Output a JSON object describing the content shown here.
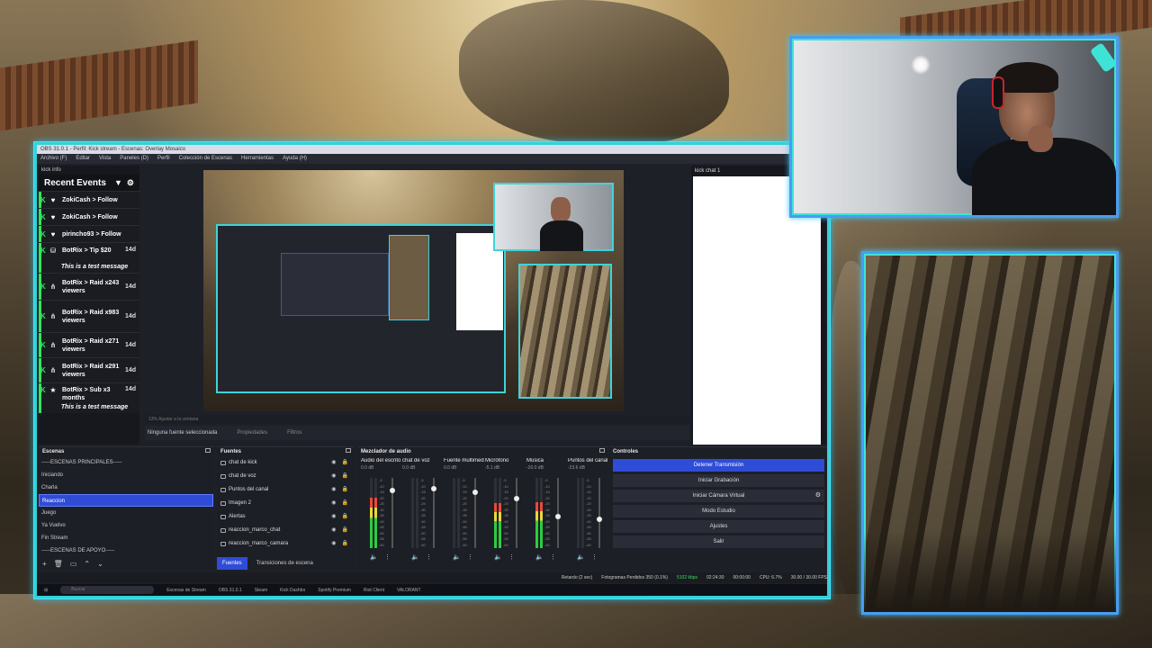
{
  "obs": {
    "titlebar": "OBS 31.0.1 - Perfil: Kick stream - Escenas: Overlay Mosaico",
    "menu": [
      "Archivo (F)",
      "Editar",
      "Vista",
      "Paneles (D)",
      "Perfil",
      "Colección de Escenas",
      "Herramientas",
      "Ayuda (H)"
    ],
    "kick_dock_title": "kick info",
    "recent_events_title": "Recent Events",
    "events": [
      {
        "text": "ZokiCash > Follow",
        "age": "",
        "icon": "heart-icon",
        "msg": ""
      },
      {
        "text": "ZokiCash > Follow",
        "age": "",
        "icon": "heart-icon",
        "msg": ""
      },
      {
        "text": "pirincho93 > Follow",
        "age": "",
        "icon": "heart-icon",
        "msg": ""
      },
      {
        "text": "BotRix > Tip $20",
        "age": "14d",
        "icon": "gift-icon",
        "msg": "This is a test message"
      },
      {
        "text": "BotRix > Raid x243 viewers",
        "age": "14d",
        "icon": "raid-icon",
        "msg": ""
      },
      {
        "text": "BotRix > Raid x983 viewers",
        "age": "14d",
        "icon": "raid-icon",
        "msg": ""
      },
      {
        "text": "BotRix > Raid x271 viewers",
        "age": "14d",
        "icon": "raid-icon",
        "msg": ""
      },
      {
        "text": "BotRix > Raid x291 viewers",
        "age": "14d",
        "icon": "raid-icon",
        "msg": ""
      },
      {
        "text": "BotRix > Sub x3 months",
        "age": "14d",
        "icon": "star-icon",
        "msg": "This is a test message"
      }
    ],
    "preview_status": "13% Ajustar a la ventana",
    "no_source": "Ninguna fuente seleccionada",
    "properties": "Propiedades",
    "filters": "Filtros",
    "chat_dock_title": "kick chat 1",
    "scenes_title": "Escenas",
    "scenes": [
      "-----ESCENAS PRINCIPALES-----",
      "Iniciando",
      "Charla",
      "Reaccion",
      "Juego",
      "Ya Vuelvo",
      "Fin Stream",
      "-----ESCENAS DE APOYO-----"
    ],
    "selected_scene": "Reaccion",
    "sources_title": "Fuentes",
    "sources": [
      "chat de kick",
      "chat de voz",
      "Puntos del canal",
      "Imagen 2",
      "Alertas",
      "reaccion_marco_chat",
      "reaccion_marco_camara"
    ],
    "mixer_title": "Mezclador de audio",
    "mixer": [
      {
        "name": "Audio del escrito",
        "db": "0.0 dB",
        "level": 0.72,
        "fader": 0.15
      },
      {
        "name": "chat de voz",
        "db": "0.0 dB",
        "level": 0.0,
        "fader": 0.12
      },
      {
        "name": "Fuente multimed",
        "db": "0.0 dB",
        "level": 0.0,
        "fader": 0.18
      },
      {
        "name": "Micrófono",
        "db": "-5.1 dB",
        "level": 0.64,
        "fader": 0.28
      },
      {
        "name": "Música",
        "db": "-20.0 dB",
        "level": 0.66,
        "fader": 0.55
      },
      {
        "name": "Puntos del canal",
        "db": "-23.6 dB",
        "level": 0.0,
        "fader": 0.6
      }
    ],
    "controls_title": "Controles",
    "controls": [
      "Detener Transmisión",
      "Iniciar Grabación",
      "Iniciar Cámara Virtual",
      "Modo Estudio",
      "Ajustes",
      "Salir"
    ],
    "tabs": [
      "Fuentes",
      "Transiciones de escena"
    ],
    "status": {
      "delay": "Retardo (2 sec)",
      "dropped": "Fotogramas Perdidos 350 (0.1%)",
      "bitrate": "5102 kbps",
      "live_time": "02:24:30",
      "rec_time": "00:00:00",
      "cpu": "CPU: 6.7%",
      "fps": "30.00 / 30.00 FPS"
    },
    "taskbar": [
      "Buscar",
      "Escenas de Stream",
      "OBS 31.0.1",
      "Steam",
      "Kick Dashbo",
      "Spotify Premium",
      "Riot Client",
      "VALORANT"
    ]
  },
  "colors": {
    "accent_blue": "#2f4cd6",
    "frame_cyan": "#3fe3d6",
    "kick_green": "#2ee85a"
  }
}
